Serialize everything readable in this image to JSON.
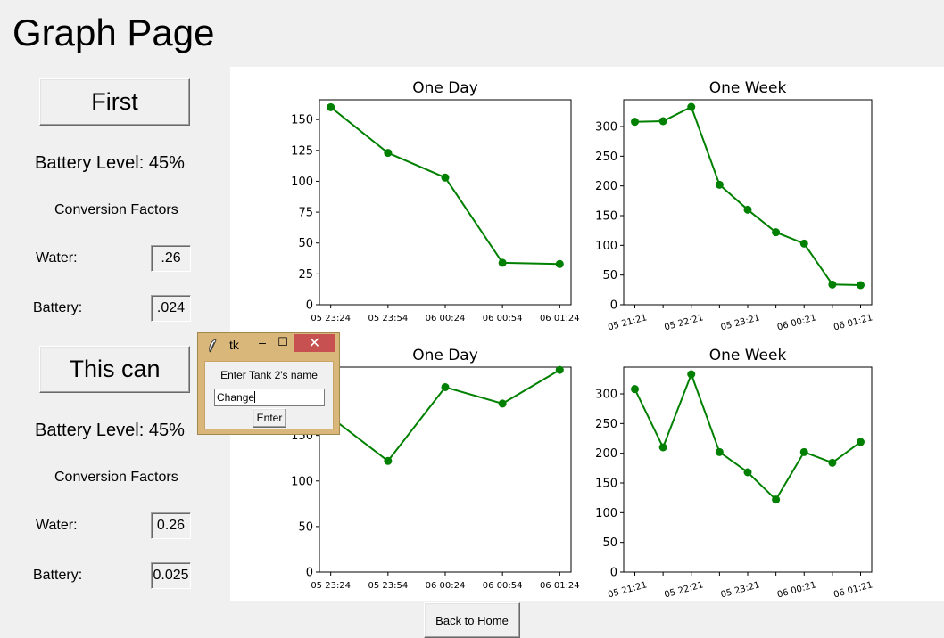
{
  "page": {
    "title": "Graph Page",
    "back_label": "Back to Home"
  },
  "tanks": [
    {
      "name": "First",
      "battery_text": "Battery Level: 45%",
      "conversion_label": "Conversion Factors",
      "water_label": "Water:",
      "water_value": ".26",
      "battery_label": "Battery:",
      "battery_value": ".024"
    },
    {
      "name": "This can",
      "battery_text": "Battery Level: 45%",
      "conversion_label": "Conversion Factors",
      "water_label": "Water:",
      "water_value": "0.26",
      "battery_label": "Battery:",
      "battery_value": "0.025"
    }
  ],
  "dialog": {
    "title": "tk",
    "prompt": "Enter Tank 2's name",
    "entry_value": "Change",
    "enter_label": "Enter",
    "close_glyph": "✕",
    "minimize_glyph": "–",
    "maximize_glyph": "☐",
    "icon": "feather-icon"
  },
  "chart_data": [
    {
      "type": "line",
      "title": "One Day",
      "x": [
        "05 23:24",
        "05 23:54",
        "06 00:24",
        "06 00:54",
        "06 01:24"
      ],
      "y": [
        160,
        123,
        103,
        34,
        33
      ],
      "yticks": [
        0,
        25,
        50,
        75,
        100,
        125,
        150
      ],
      "ylim": [
        0,
        166
      ],
      "color": "#008000"
    },
    {
      "type": "line",
      "title": "One Week",
      "x": [
        "05 21:21",
        "",
        "05 22:21",
        "",
        "05 23:21",
        "",
        "06 00:21",
        "",
        "06 01:21"
      ],
      "y": [
        308,
        309,
        333,
        202,
        160,
        122,
        103,
        34,
        33
      ],
      "xticks": [
        "05 21:21",
        "05 22:21",
        "05 23:21",
        "06 00:21",
        "06 01:21"
      ],
      "yticks": [
        0,
        50,
        100,
        150,
        200,
        250,
        300
      ],
      "ylim": [
        0,
        345
      ],
      "color": "#008000"
    },
    {
      "type": "line",
      "title": "One Day",
      "x": [
        "05 23:24",
        "05 23:54",
        "06 00:24",
        "06 00:54",
        "06 01:24"
      ],
      "y": [
        170,
        122,
        203,
        185,
        222
      ],
      "yticks": [
        0,
        50,
        100,
        150
      ],
      "ylim": [
        0,
        225
      ],
      "color": "#008000"
    },
    {
      "type": "line",
      "title": "One Week",
      "x": [
        "05 21:21",
        "",
        "05 22:21",
        "",
        "05 23:21",
        "",
        "06 00:21",
        "",
        "06 01:21"
      ],
      "y": [
        308,
        210,
        333,
        202,
        168,
        122,
        202,
        184,
        219
      ],
      "xticks": [
        "05 21:21",
        "05 22:21",
        "05 23:21",
        "06 00:21",
        "06 01:21"
      ],
      "yticks": [
        0,
        50,
        100,
        150,
        200,
        250,
        300
      ],
      "ylim": [
        0,
        345
      ],
      "color": "#008000"
    }
  ]
}
